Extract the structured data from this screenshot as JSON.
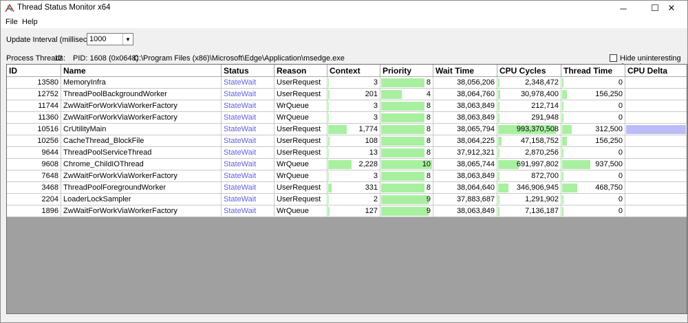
{
  "window": {
    "title": "Thread Status Monitor x64",
    "minimize_glyph": "─",
    "maximize_glyph": "☐",
    "close_glyph": "✕"
  },
  "menu": {
    "file": "File",
    "help": "Help"
  },
  "interval": {
    "label": "Update Interval (milliseconds):",
    "value": "1000",
    "arrow": "▼"
  },
  "info": {
    "threads_label": "Process Threads:",
    "threads_value": "12",
    "pid": "PID: 1608 (0x0648)",
    "path": "C:\\Program Files (x86)\\Microsoft\\Edge\\Application\\msedge.exe",
    "hide_label": "Hide uninteresting threads"
  },
  "columns": [
    "ID",
    "Name",
    "Status",
    "Reason",
    "Context",
    "Priority",
    "Wait Time",
    "CPU Cycles",
    "Thread Time",
    "CPU Delta"
  ],
  "rows": [
    {
      "id": "13580",
      "name": "MemoryInfra",
      "status": "StateWait",
      "reason": "UserRequest",
      "context": "3",
      "context_frac": 0.02,
      "priority": "8",
      "priority_frac": 0.85,
      "wait": "38,056,206",
      "cycles": "2,348,472",
      "cycles_frac": 0.02,
      "ttime": "0",
      "ttime_frac": 0.02,
      "delta_frac": 0
    },
    {
      "id": "12752",
      "name": "ThreadPoolBackgroundWorker",
      "status": "StateWait",
      "reason": "UserRequest",
      "context": "201",
      "context_frac": 0.03,
      "priority": "4",
      "priority_frac": 0.4,
      "wait": "38,064,760",
      "cycles": "30,978,400",
      "cycles_frac": 0.03,
      "ttime": "156,250",
      "ttime_frac": 0.08,
      "delta_frac": 0
    },
    {
      "id": "11744",
      "name": "ZwWaitForWorkViaWorkerFactory",
      "status": "StateWait",
      "reason": "WrQueue",
      "context": "3",
      "context_frac": 0.02,
      "priority": "8",
      "priority_frac": 0.85,
      "wait": "38,063,849",
      "cycles": "212,714",
      "cycles_frac": 0.02,
      "ttime": "0",
      "ttime_frac": 0.02,
      "delta_frac": 0
    },
    {
      "id": "11360",
      "name": "ZwWaitForWorkViaWorkerFactory",
      "status": "StateWait",
      "reason": "WrQueue",
      "context": "3",
      "context_frac": 0.02,
      "priority": "8",
      "priority_frac": 0.85,
      "wait": "38,063,849",
      "cycles": "291,948",
      "cycles_frac": 0.02,
      "ttime": "0",
      "ttime_frac": 0.02,
      "delta_frac": 0
    },
    {
      "id": "10516",
      "name": "CrUtilityMain",
      "status": "StateWait",
      "reason": "UserRequest",
      "context": "1,774",
      "context_frac": 0.36,
      "priority": "8",
      "priority_frac": 0.85,
      "wait": "38,065,794",
      "cycles": "993,370,508",
      "cycles_frac": 0.93,
      "ttime": "312,500",
      "ttime_frac": 0.15,
      "delta_frac": 1
    },
    {
      "id": "10256",
      "name": "CacheThread_BlockFile",
      "status": "StateWait",
      "reason": "UserRequest",
      "context": "108",
      "context_frac": 0.03,
      "priority": "8",
      "priority_frac": 0.85,
      "wait": "38,064,225",
      "cycles": "47,158,752",
      "cycles_frac": 0.05,
      "ttime": "156,250",
      "ttime_frac": 0.08,
      "delta_frac": 0
    },
    {
      "id": "9644",
      "name": "ThreadPoolServiceThread",
      "status": "StateWait",
      "reason": "UserRequest",
      "context": "13",
      "context_frac": 0.02,
      "priority": "8",
      "priority_frac": 0.85,
      "wait": "37,912,321",
      "cycles": "2,870,256",
      "cycles_frac": 0.02,
      "ttime": "0",
      "ttime_frac": 0.02,
      "delta_frac": 0
    },
    {
      "id": "9608",
      "name": "Chrome_ChildIOThread",
      "status": "StateWait",
      "reason": "WrQueue",
      "context": "2,228",
      "context_frac": 0.46,
      "priority": "10",
      "priority_frac": 1.0,
      "wait": "38,065,744",
      "cycles": "691,997,802",
      "cycles_frac": 0.33,
      "ttime": "937,500",
      "ttime_frac": 0.45,
      "delta_frac": 0
    },
    {
      "id": "7648",
      "name": "ZwWaitForWorkViaWorkerFactory",
      "status": "StateWait",
      "reason": "WrQueue",
      "context": "3",
      "context_frac": 0.02,
      "priority": "8",
      "priority_frac": 0.85,
      "wait": "38,063,849",
      "cycles": "872,700",
      "cycles_frac": 0.02,
      "ttime": "0",
      "ttime_frac": 0.02,
      "delta_frac": 0
    },
    {
      "id": "3468",
      "name": "ThreadPoolForegroundWorker",
      "status": "StateWait",
      "reason": "UserRequest",
      "context": "331",
      "context_frac": 0.07,
      "priority": "8",
      "priority_frac": 0.85,
      "wait": "38,064,640",
      "cycles": "346,906,945",
      "cycles_frac": 0.17,
      "ttime": "468,750",
      "ttime_frac": 0.24,
      "delta_frac": 0
    },
    {
      "id": "2204",
      "name": "LoaderLockSampler",
      "status": "StateWait",
      "reason": "UserRequest",
      "context": "2",
      "context_frac": 0.02,
      "priority": "9",
      "priority_frac": 0.93,
      "wait": "37,883,687",
      "cycles": "1,291,902",
      "cycles_frac": 0.02,
      "ttime": "0",
      "ttime_frac": 0.02,
      "delta_frac": 0
    },
    {
      "id": "1896",
      "name": "ZwWaitForWorkViaWorkerFactory",
      "status": "StateWait",
      "reason": "WrQueue",
      "context": "127",
      "context_frac": 0.03,
      "priority": "9",
      "priority_frac": 0.93,
      "wait": "38,063,849",
      "cycles": "7,136,187",
      "cycles_frac": 0.02,
      "ttime": "0",
      "ttime_frac": 0.02,
      "delta_frac": 0
    }
  ]
}
